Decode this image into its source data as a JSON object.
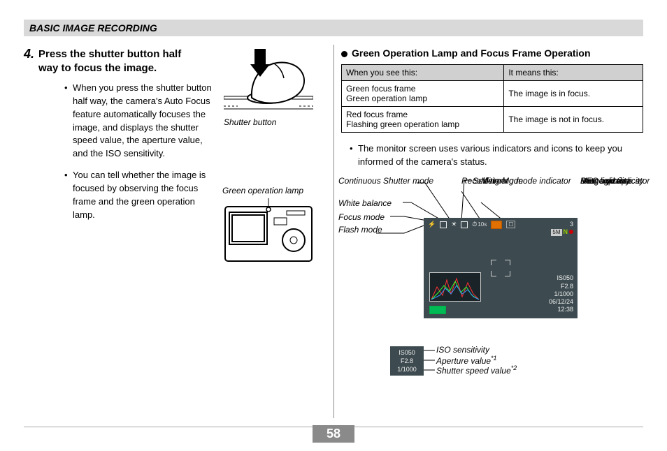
{
  "header": {
    "section": "BASIC IMAGE RECORDING"
  },
  "page_number": "58",
  "step": {
    "number": "4.",
    "title": "Press the shutter button half way to focus the image.",
    "bullets": [
      "When you press the shutter button half way, the camera's Auto Focus feature automatically focuses the image, and displays the shutter speed value, the aperture value, and the ISO sensitivity.",
      "You can tell whether the image is focused by observing the focus frame and the green operation lamp."
    ]
  },
  "figures": {
    "shutter_caption": "Shutter button",
    "lamp_caption": "Green operation lamp"
  },
  "right": {
    "title": "Green Operation Lamp and Focus Frame Operation",
    "table": {
      "head_left": "When you see this:",
      "head_right": "It means this:",
      "rows": [
        {
          "left1": "Green focus frame",
          "left2": "Green operation lamp",
          "right": "The image is in focus."
        },
        {
          "left1": "Red focus frame",
          "left2": "Flashing green operation lamp",
          "right": "The image is not in focus."
        }
      ]
    },
    "note": "The monitor screen uses various indicators and icons to keep you informed of the camera's status."
  },
  "monitor_labels": {
    "cont_shutter": "Continuous Shutter mode",
    "white_balance": "White balance",
    "focus_mode": "Focus mode",
    "flash_mode": "Flash mode",
    "self_timer": "Self-timer",
    "recording_mode": "Recording Mode",
    "metering": "Metering mode indicator",
    "memory": "Memory capacity",
    "image_quality": "Image quality",
    "rec_light": "REC light indicator",
    "image_size": "Image size",
    "date_time": "Date and time"
  },
  "screen": {
    "timer": "10s",
    "meter": "☐",
    "remaining": "3",
    "quality_badge": "5M",
    "quality_letter": "N",
    "iso": "IS050",
    "aperture": "F2.8",
    "shutter": "1/1000",
    "date": "06/12/24",
    "time": "12:38"
  },
  "iso_panel": {
    "iso": "IS050",
    "aperture": "F2.8",
    "shutter": "1/1000",
    "label_iso": "ISO sensitivity",
    "label_aperture": "Aperture value",
    "label_shutter": "Shutter speed value",
    "sup1": "*1",
    "sup2": "*2"
  }
}
